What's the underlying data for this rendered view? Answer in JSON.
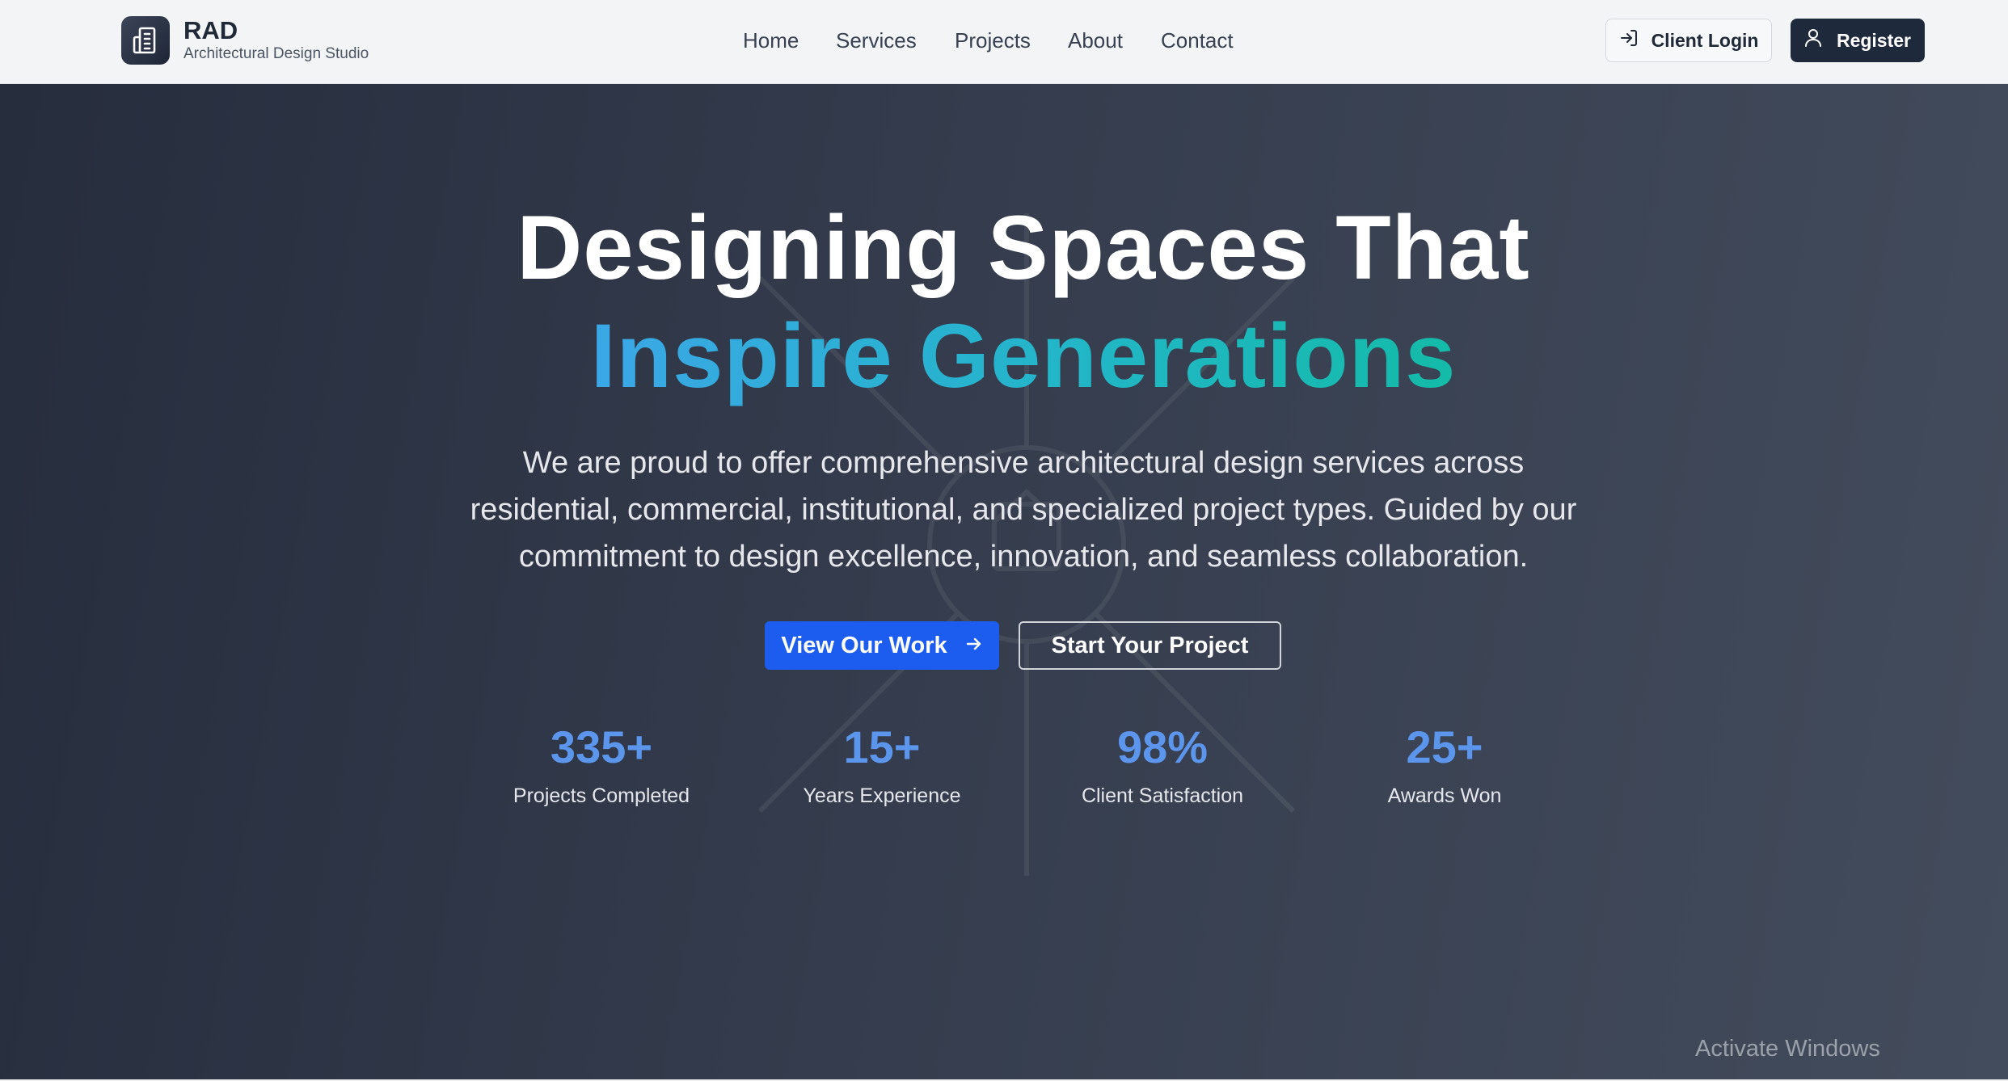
{
  "brand": {
    "name": "RAD",
    "tagline": "Architectural Design Studio",
    "logo_icon": "building-icon"
  },
  "nav": {
    "items": [
      {
        "label": "Home"
      },
      {
        "label": "Services"
      },
      {
        "label": "Projects"
      },
      {
        "label": "About"
      },
      {
        "label": "Contact"
      }
    ]
  },
  "header_actions": {
    "login_label": "Client Login",
    "login_icon": "login-arrow-icon",
    "register_label": "Register",
    "register_icon": "user-icon"
  },
  "hero": {
    "headline_line1": "Designing Spaces That",
    "headline_line2": "Inspire Generations",
    "lead": "We are proud to offer comprehensive architectural design services across residential, commercial, institutional, and specialized project types. Guided by our commitment to design excellence, innovation, and seamless collaboration.",
    "primary_cta": "View Our Work",
    "primary_cta_icon": "arrow-right-icon",
    "secondary_cta": "Start Your Project"
  },
  "stats": [
    {
      "value": "335+",
      "label": "Projects Completed"
    },
    {
      "value": "15+",
      "label": "Years Experience"
    },
    {
      "value": "98%",
      "label": "Client Satisfaction"
    },
    {
      "value": "25+",
      "label": "Awards Won"
    }
  ],
  "os_overlay": {
    "watermark": "Activate Windows"
  },
  "colors": {
    "header_bg": "#f3f4f6",
    "hero_bg_start": "#262d3d",
    "hero_bg_end": "#434c5c",
    "accent_blue": "#1c5df0",
    "stat_blue": "#5b95ec",
    "gradient_start": "#3ba7e6",
    "gradient_end": "#14bba8",
    "register_bg": "#1e293b"
  }
}
